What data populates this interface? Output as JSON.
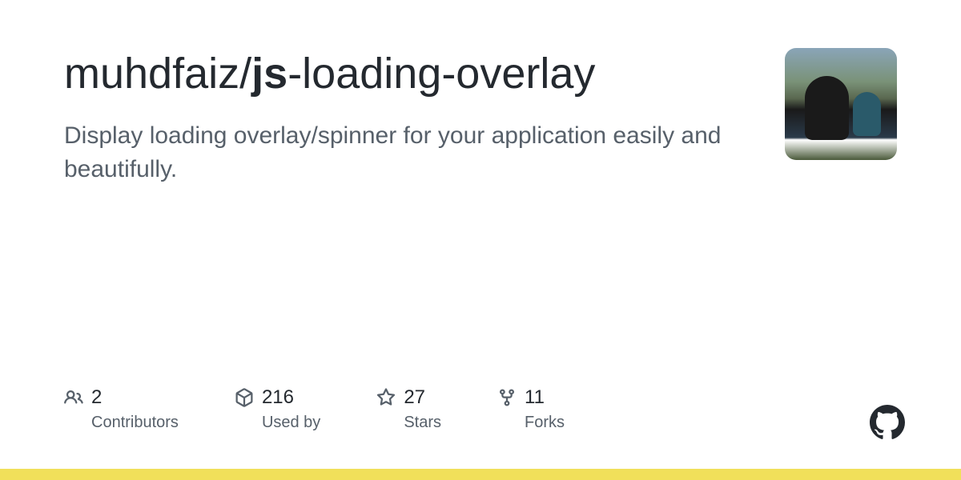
{
  "repo": {
    "owner": "muhdfaiz",
    "name": "js-loading-overlay",
    "name_parts": {
      "bold": "js",
      "rest": "-loading-overlay"
    },
    "description": "Display loading overlay/spinner for your application easily and beautifully."
  },
  "stats": {
    "contributors": {
      "value": "2",
      "label": "Contributors"
    },
    "usedby": {
      "value": "216",
      "label": "Used by"
    },
    "stars": {
      "value": "27",
      "label": "Stars"
    },
    "forks": {
      "value": "11",
      "label": "Forks"
    }
  },
  "colors": {
    "language_bar": "#f1e05a"
  }
}
